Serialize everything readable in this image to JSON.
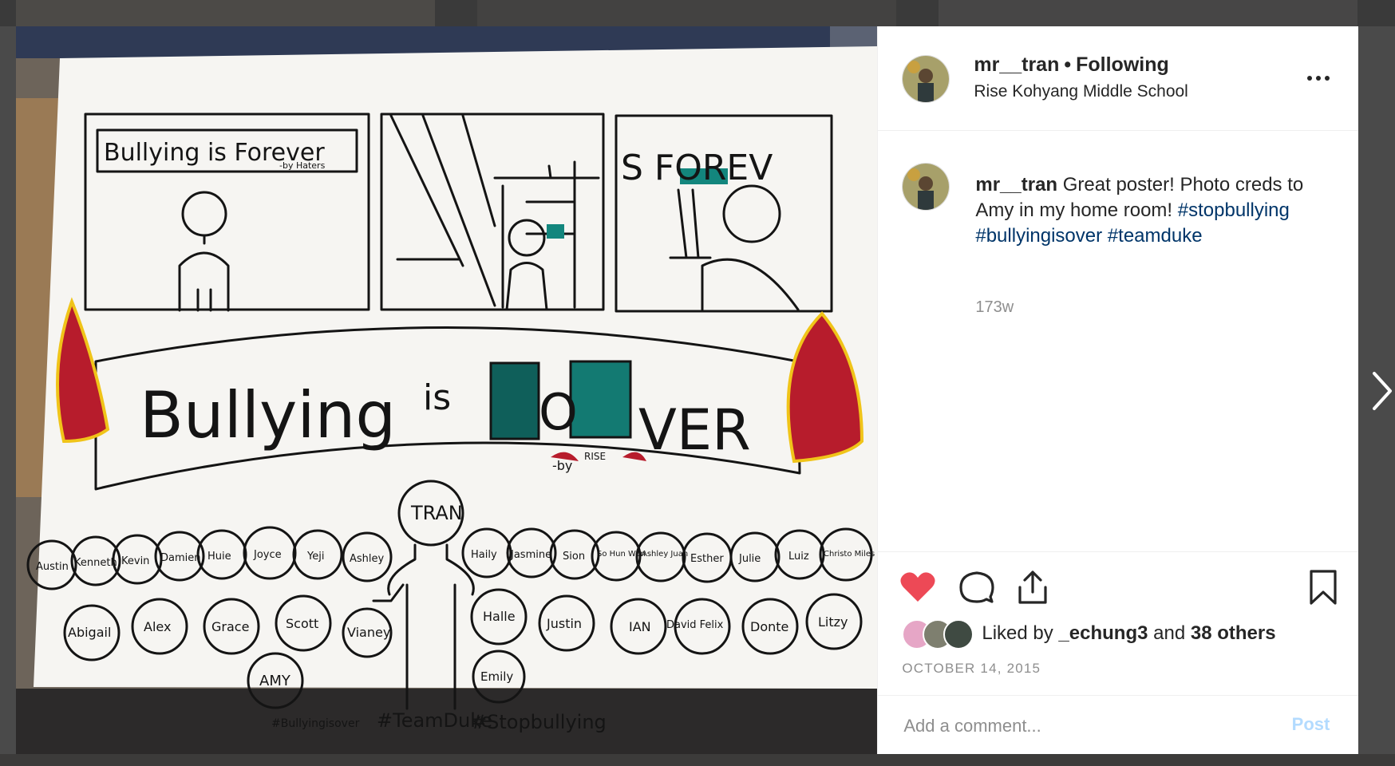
{
  "post": {
    "username": "mr__tran",
    "separator": "•",
    "follow_status": "Following",
    "location": "Rise Kohyang Middle School",
    "caption": {
      "username": "mr__tran",
      "text": "Great poster! Photo creds to Amy in my home room!",
      "hashtags": [
        "#stopbullying",
        "#bullyingisover",
        "#teamduke"
      ],
      "age": "173w"
    },
    "likes": {
      "prefix": "Liked by",
      "first_liker": "_echung3",
      "joiner": "and",
      "others": "38 others"
    },
    "date": "OCTOBER 14, 2015",
    "comment": {
      "placeholder": "Add a comment...",
      "post_label": "Post"
    }
  },
  "icons": {
    "more": "more-options-icon",
    "heart": "heart-icon",
    "comment": "comment-icon",
    "share": "share-icon",
    "bookmark": "bookmark-icon",
    "next": "chevron-right-icon"
  },
  "colors": {
    "heart": "#ed4956",
    "hashtag": "#003569",
    "post_button_disabled": "#b3dbff",
    "muted_text": "#8e8e8e"
  },
  "photo": {
    "panel1_sign": "Bullying is Forever",
    "panel1_sign_credit": "-by Haters",
    "panel3_sign": "S FOREV",
    "banner_word1": "Bullying",
    "banner_word2": "is",
    "banner_word3": "VER",
    "banner_letter_o": "O",
    "banner_credit": "-by",
    "banner_credit_rise": "RISE",
    "center_figure": "TRAN",
    "names_back": [
      "Austin",
      "Kenneth",
      "Kevin",
      "Damien",
      "Huie",
      "Joyce",
      "Yeji",
      "Ashley",
      "Haily",
      "Jasmine",
      "Sion",
      "So Hun Won",
      "Ashley Juan",
      "Esther",
      "Julie",
      "Luiz",
      "Christo Miles"
    ],
    "names_front": [
      "Abigail",
      "Alex",
      "Grace",
      "Scott",
      "Vianey",
      "Halle",
      "Justin",
      "IAN",
      "David Felix",
      "Donte",
      "Litzy"
    ],
    "names_bottom": [
      "AMY",
      "Emily"
    ],
    "hashtags": [
      "#Bullyingisover",
      "#TeamDuke",
      "#Stopbullying"
    ]
  }
}
